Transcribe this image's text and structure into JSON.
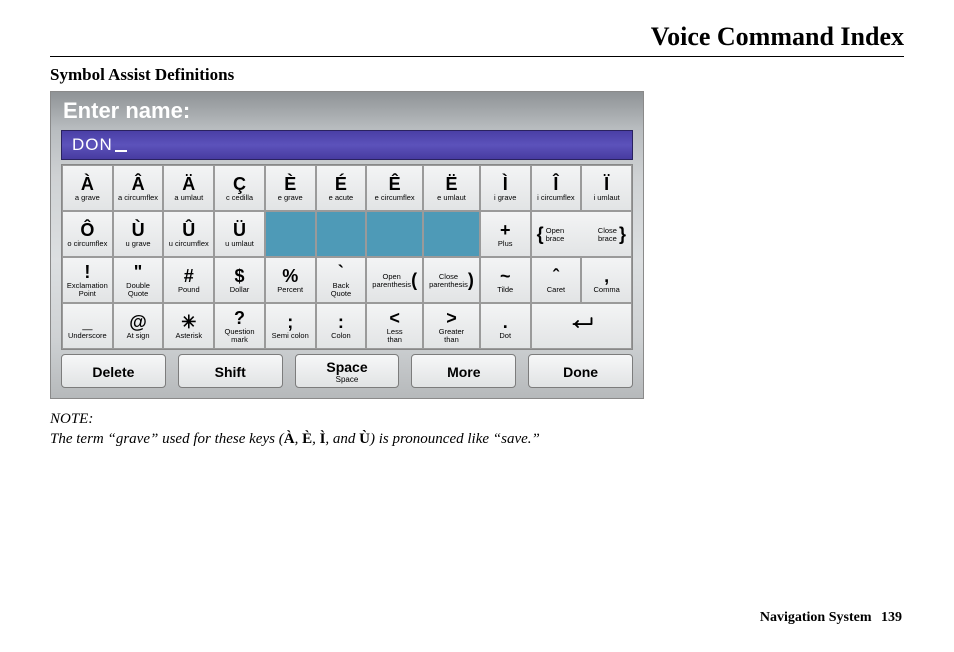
{
  "header": {
    "title": "Voice Command Index"
  },
  "section": {
    "title": "Symbol Assist Definitions"
  },
  "screen": {
    "title": "Enter name:",
    "input_value": "DON"
  },
  "keys": {
    "r1": [
      {
        "sym": "À",
        "lbl": "a grave"
      },
      {
        "sym": "Â",
        "lbl": "a circumflex"
      },
      {
        "sym": "Ä",
        "lbl": "a umlaut"
      },
      {
        "sym": "Ç",
        "lbl": "c cedilla"
      },
      {
        "sym": "È",
        "lbl": "e grave"
      },
      {
        "sym": "É",
        "lbl": "e acute"
      },
      {
        "sym": "Ê",
        "lbl": "e circumflex"
      },
      {
        "sym": "Ë",
        "lbl": "e umlaut"
      },
      {
        "sym": "Ì",
        "lbl": "i grave"
      },
      {
        "sym": "Î",
        "lbl": "i circumflex"
      },
      {
        "sym": "Ï",
        "lbl": "i umlaut"
      }
    ],
    "r2": [
      {
        "sym": "Ô",
        "lbl": "o circumflex"
      },
      {
        "sym": "Ù",
        "lbl": "u grave"
      },
      {
        "sym": "Û",
        "lbl": "u circumflex"
      },
      {
        "sym": "Ü",
        "lbl": "u umlaut"
      },
      {
        "empty": true
      },
      {
        "empty": true
      },
      {
        "empty": true
      },
      {
        "empty": true
      },
      {
        "sym": "+",
        "lbl": "Plus"
      },
      {
        "inline": true,
        "left_sym": "{",
        "left_lbl": "Open\nbrace",
        "right_lbl": "Close\nbrace",
        "right_sym": "}",
        "span": 2
      }
    ],
    "r3": [
      {
        "sym": "!",
        "lbl": "Exclamation\nPoint"
      },
      {
        "sym": "\"",
        "lbl": "Double\nQuote"
      },
      {
        "sym": "#",
        "lbl": "Pound"
      },
      {
        "sym": "$",
        "lbl": "Dollar"
      },
      {
        "sym": "%",
        "lbl": "Percent"
      },
      {
        "sym": "`",
        "lbl": "Back\nQuote"
      },
      {
        "inline": true,
        "lbl": "Open\nparenthesis",
        "sym": "("
      },
      {
        "inline": true,
        "lbl": "Close\nparenthesis",
        "sym": ")"
      },
      {
        "sym": "~",
        "lbl": "Tilde"
      },
      {
        "sym": "ˆ",
        "lbl": "Caret"
      },
      {
        "sym": ",",
        "lbl": "Comma"
      }
    ],
    "r4": [
      {
        "sym": "_",
        "lbl": "Underscore",
        "small": true
      },
      {
        "sym": "@",
        "lbl": "At sign"
      },
      {
        "sym": "✳",
        "lbl": "Asterisk"
      },
      {
        "sym": "?",
        "lbl": "Question\nmark"
      },
      {
        "sym": ";",
        "lbl": "Semi colon"
      },
      {
        "sym": ":",
        "lbl": "Colon"
      },
      {
        "sym": "<",
        "lbl": "Less\nthan"
      },
      {
        "sym": ">",
        "lbl": "Greater\nthan"
      },
      {
        "sym": ".",
        "lbl": "Dot"
      },
      {
        "enter": true,
        "span": 2
      }
    ]
  },
  "actions": {
    "delete": "Delete",
    "shift": "Shift",
    "space": "Space",
    "space_sub": "Space",
    "more": "More",
    "done": "Done"
  },
  "note": {
    "label": "NOTE:",
    "pre": "The term “grave” used for these keys (",
    "list": [
      "À",
      "È",
      "Ì",
      "Ù"
    ],
    "sep": ", ",
    "last_sep": ", and ",
    "post": ") is pronounced like “save.”"
  },
  "footer": {
    "label": "Navigation System",
    "page": "139"
  }
}
